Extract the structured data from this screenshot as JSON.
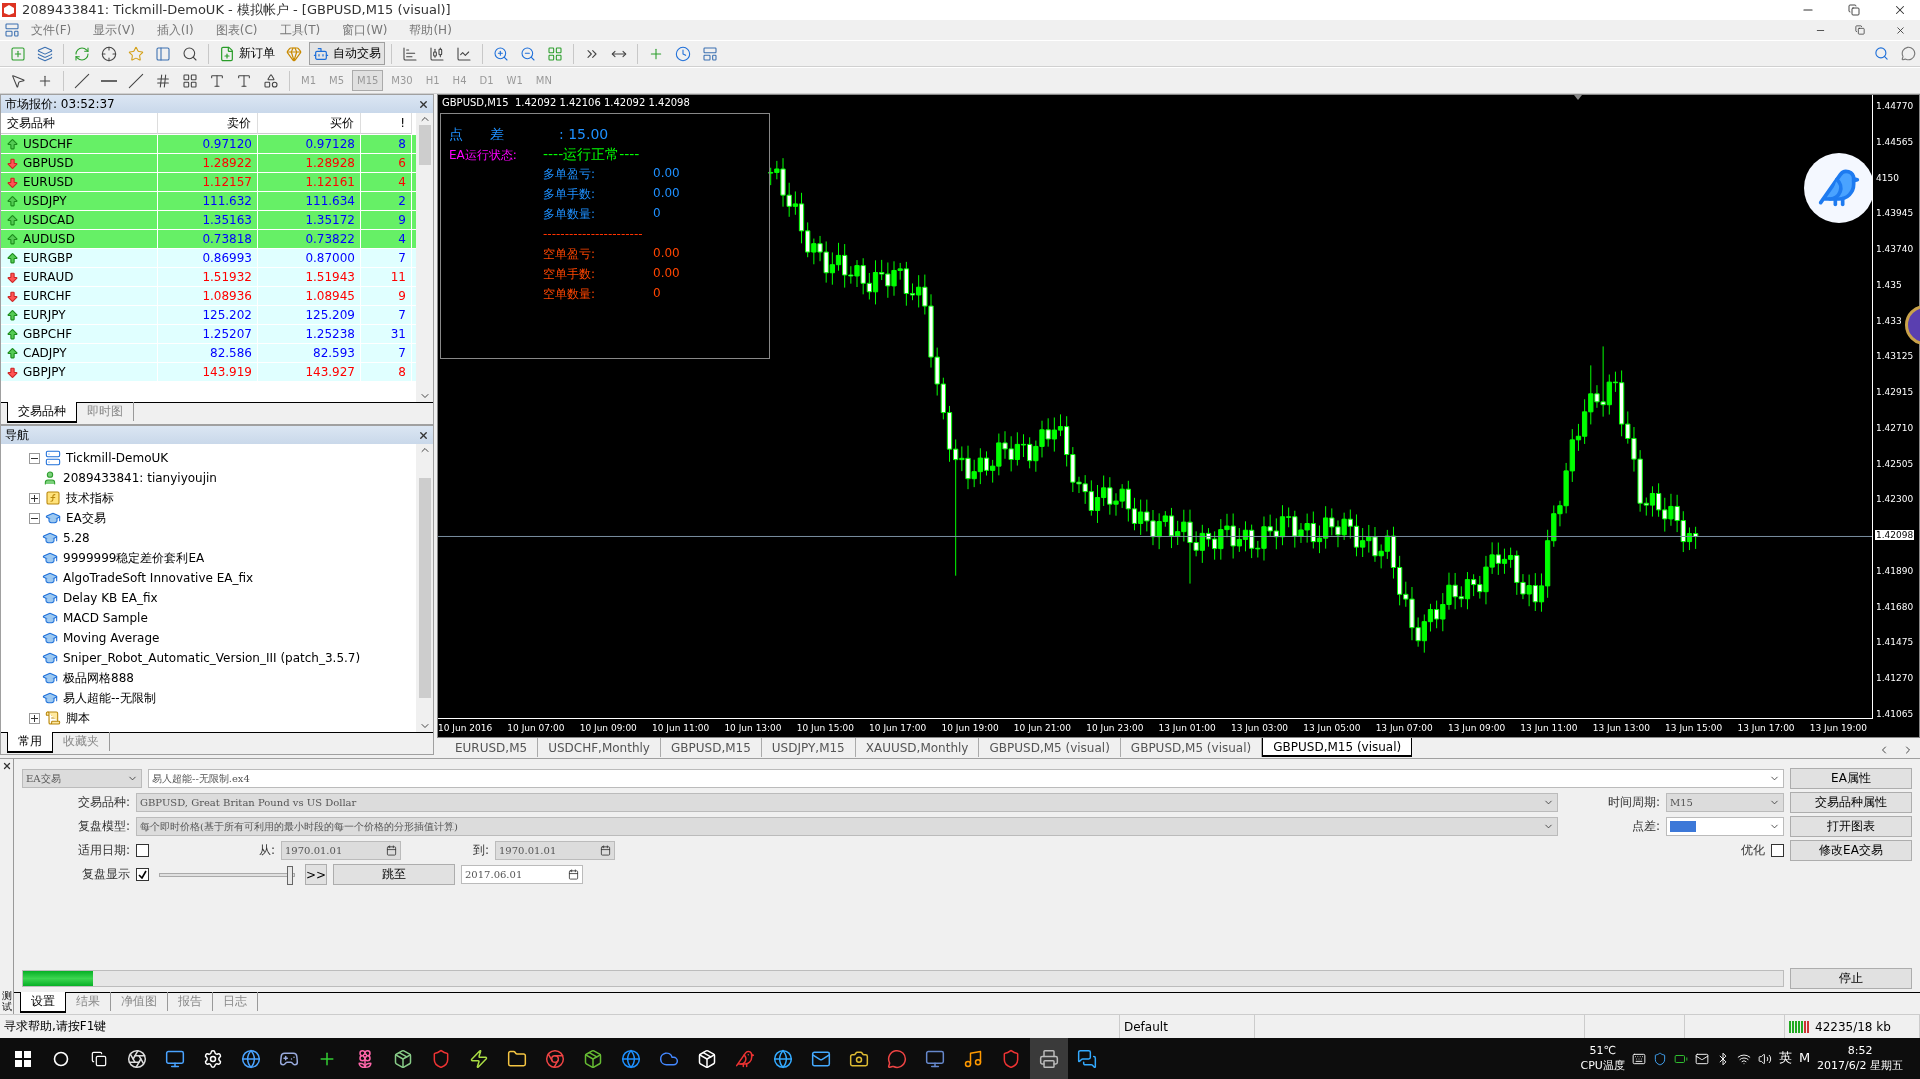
{
  "window": {
    "title": "2089433841: Tickmill-DemoUK - 模拟帐户 - [GBPUSD,M15 (visual)]"
  },
  "menu": [
    "文件(F)",
    "显示(V)",
    "插入(I)",
    "图表(C)",
    "工具(T)",
    "窗口(W)",
    "帮助(H)"
  ],
  "toolbar": {
    "new_order": "新订单",
    "auto_trading": "自动交易"
  },
  "timeframes": [
    {
      "label": "M1",
      "selected": false
    },
    {
      "label": "M5",
      "selected": false
    },
    {
      "label": "M15",
      "selected": true
    },
    {
      "label": "M30",
      "selected": false
    },
    {
      "label": "H1",
      "selected": false
    },
    {
      "label": "H4",
      "selected": false
    },
    {
      "label": "D1",
      "selected": false
    },
    {
      "label": "W1",
      "selected": false
    },
    {
      "label": "MN",
      "selected": false
    }
  ],
  "market_watch": {
    "title": "市场报价: 03:52:37",
    "columns": [
      "交易品种",
      "卖价",
      "买价",
      "!"
    ],
    "rows": [
      {
        "symbol": "USDCHF",
        "bid": "0.97120",
        "ask": "0.97128",
        "spread": "8",
        "rising": true,
        "highlighted": true
      },
      {
        "symbol": "GBPUSD",
        "bid": "1.28922",
        "ask": "1.28928",
        "spread": "6",
        "rising": false,
        "highlighted": true
      },
      {
        "symbol": "EURUSD",
        "bid": "1.12157",
        "ask": "1.12161",
        "spread": "4",
        "rising": false,
        "highlighted": true
      },
      {
        "symbol": "USDJPY",
        "bid": "111.632",
        "ask": "111.634",
        "spread": "2",
        "rising": true,
        "highlighted": true
      },
      {
        "symbol": "USDCAD",
        "bid": "1.35163",
        "ask": "1.35172",
        "spread": "9",
        "rising": true,
        "highlighted": true
      },
      {
        "symbol": "AUDUSD",
        "bid": "0.73818",
        "ask": "0.73822",
        "spread": "4",
        "rising": true,
        "highlighted": true
      },
      {
        "symbol": "EURGBP",
        "bid": "0.86993",
        "ask": "0.87000",
        "spread": "7",
        "rising": true,
        "highlighted": false
      },
      {
        "symbol": "EURAUD",
        "bid": "1.51932",
        "ask": "1.51943",
        "spread": "11",
        "rising": false,
        "highlighted": false
      },
      {
        "symbol": "EURCHF",
        "bid": "1.08936",
        "ask": "1.08945",
        "spread": "9",
        "rising": false,
        "highlighted": false
      },
      {
        "symbol": "EURJPY",
        "bid": "125.202",
        "ask": "125.209",
        "spread": "7",
        "rising": true,
        "highlighted": false
      },
      {
        "symbol": "GBPCHF",
        "bid": "1.25207",
        "ask": "1.25238",
        "spread": "31",
        "rising": true,
        "highlighted": false
      },
      {
        "symbol": "CADJPY",
        "bid": "82.586",
        "ask": "82.593",
        "spread": "7",
        "rising": true,
        "highlighted": false
      },
      {
        "symbol": "GBPJPY",
        "bid": "143.919",
        "ask": "143.927",
        "spread": "8",
        "rising": false,
        "highlighted": false
      }
    ],
    "tabs": [
      {
        "label": "交易品种",
        "selected": true
      },
      {
        "label": "即时图",
        "selected": false
      }
    ]
  },
  "navigator": {
    "title": "导航",
    "items": [
      {
        "label": "Tickmill-DemoUK",
        "kind": "server",
        "expanded": true,
        "children": [
          {
            "label": "2089433841: tianyiyoujin",
            "kind": "account"
          }
        ]
      },
      {
        "label": "技术指标",
        "kind": "indicators",
        "expanded": false
      },
      {
        "label": "EA交易",
        "kind": "experts",
        "expanded": true,
        "children": [
          {
            "label": "5.28",
            "kind": "expert"
          },
          {
            "label": "9999999稳定差价套利EA",
            "kind": "expert"
          },
          {
            "label": "AlgoTradeSoft Innovative EA_fix",
            "kind": "expert"
          },
          {
            "label": "Delay KB EA_fix",
            "kind": "expert"
          },
          {
            "label": "MACD Sample",
            "kind": "expert"
          },
          {
            "label": "Moving Average",
            "kind": "expert"
          },
          {
            "label": "Sniper_Robot_Automatic_Version_III (patch_3.5.7)",
            "kind": "expert"
          },
          {
            "label": "极品网格888",
            "kind": "expert"
          },
          {
            "label": "易人超能--无限制",
            "kind": "expert"
          }
        ]
      },
      {
        "label": "脚本",
        "kind": "scripts",
        "expanded": false
      }
    ],
    "tabs": [
      {
        "label": "常用",
        "selected": true
      },
      {
        "label": "收藏夹",
        "selected": false
      }
    ]
  },
  "chart": {
    "header": "GBPUSD,M15  1.42092 1.42106 1.42092 1.42098",
    "ea_panel": [
      {
        "kind": "spread",
        "label": "点      差",
        "value": ": 15.00"
      },
      {
        "kind": "status",
        "label": "EA运行状态:",
        "value": "----运行正常----"
      },
      {
        "kind": "long",
        "label": "多单盈亏:",
        "value": "0.00"
      },
      {
        "kind": "long",
        "label": "多单手数:",
        "value": "0.00"
      },
      {
        "kind": "long",
        "label": "多单数量:",
        "value": "0"
      },
      {
        "kind": "divider",
        "label": "-----------------------"
      },
      {
        "kind": "short",
        "label": "空单盈亏:",
        "value": "0.00"
      },
      {
        "kind": "short",
        "label": "空单手数:",
        "value": "0.00"
      },
      {
        "kind": "short",
        "label": "空单数量:",
        "value": "0"
      }
    ],
    "price_axis": [
      {
        "label": "1.44770",
        "current": false
      },
      {
        "label": "1.44565",
        "current": false
      },
      {
        "label": "4150",
        "current": false
      },
      {
        "label": "1.43945",
        "current": false
      },
      {
        "label": "1.43740",
        "current": false
      },
      {
        "label": "1.435",
        "current": false
      },
      {
        "label": "1.433",
        "current": false
      },
      {
        "label": "1.43125",
        "current": false
      },
      {
        "label": "1.42915",
        "current": false
      },
      {
        "label": "1.42710",
        "current": false
      },
      {
        "label": "1.42505",
        "current": false
      },
      {
        "label": "1.42300",
        "current": false
      },
      {
        "label": "1.42098",
        "current": true
      },
      {
        "label": "1.41890",
        "current": false
      },
      {
        "label": "1.41680",
        "current": false
      },
      {
        "label": "1.41475",
        "current": false
      },
      {
        "label": "1.41270",
        "current": false
      },
      {
        "label": "1.41065",
        "current": false
      }
    ],
    "time_axis": [
      "10 Jun 2016",
      "10 Jun 07:00",
      "10 Jun 09:00",
      "10 Jun 11:00",
      "10 Jun 13:00",
      "10 Jun 15:00",
      "10 Jun 17:00",
      "10 Jun 19:00",
      "10 Jun 21:00",
      "10 Jun 23:00",
      "13 Jun 01:00",
      "13 Jun 03:00",
      "13 Jun 05:00",
      "13 Jun 07:00",
      "13 Jun 09:00",
      "13 Jun 11:00",
      "13 Jun 13:00",
      "13 Jun 15:00",
      "13 Jun 17:00",
      "13 Jun 19:00"
    ],
    "tabs": [
      {
        "label": "EURUSD,M5",
        "selected": false
      },
      {
        "label": "USDCHF,Monthly",
        "selected": false
      },
      {
        "label": "GBPUSD,M15",
        "selected": false
      },
      {
        "label": "USDJPY,M15",
        "selected": false
      },
      {
        "label": "XAUUSD,Monthly",
        "selected": false
      },
      {
        "label": "GBPUSD,M5 (visual)",
        "selected": false
      },
      {
        "label": "GBPUSD,M5 (visual)",
        "selected": false
      },
      {
        "label": "GBPUSD,M15 (visual)",
        "selected": true
      }
    ]
  },
  "tester": {
    "side_label": "测试",
    "expert_type": "EA交易",
    "expert": "易人超能--无限制.ex4",
    "symbol_label": "交易品种:",
    "symbol": "GBPUSD, Great Britan Pound vs US Dollar",
    "period_label": "时间周期:",
    "period": "M15",
    "model_label": "复盘模型:",
    "model": "每个即时价格(基于所有可利用的最小时段的每一个价格的分形插值计算)",
    "spread_label": "点差:",
    "use_date": {
      "label": "适用日期:",
      "checked": false
    },
    "from_label": "从:",
    "from": "1970.01.01",
    "to_label": "到:",
    "to": "1970.01.01",
    "optimize": {
      "label": "优化",
      "checked": false
    },
    "visual": {
      "label": "复盘显示",
      "checked": true
    },
    "speed": {
      "level": 0.97
    },
    "skip_button": ">>",
    "goto_button": "跳至",
    "goto_date": "2017.06.01",
    "progress": {
      "level": 0.04
    },
    "buttons": [
      "EA属性",
      "交易品种属性",
      "打开图表",
      "修改EA交易"
    ],
    "stop_button": "停止",
    "tabs": [
      {
        "label": "设置",
        "selected": true
      },
      {
        "label": "结果",
        "selected": false
      },
      {
        "label": "净值图",
        "selected": false
      },
      {
        "label": "报告",
        "selected": false
      },
      {
        "label": "日志",
        "selected": false
      }
    ]
  },
  "status_bar": {
    "help": "寻求帮助,请按F1键",
    "profile": "Default",
    "traffic": "42235/18 kb"
  },
  "taskbar": {
    "temperature": "51℃",
    "temperature_label": "CPU温度",
    "ime": "英",
    "ime_mode": "M",
    "time": "8:52",
    "date": "2017/6/2 星期五"
  }
}
